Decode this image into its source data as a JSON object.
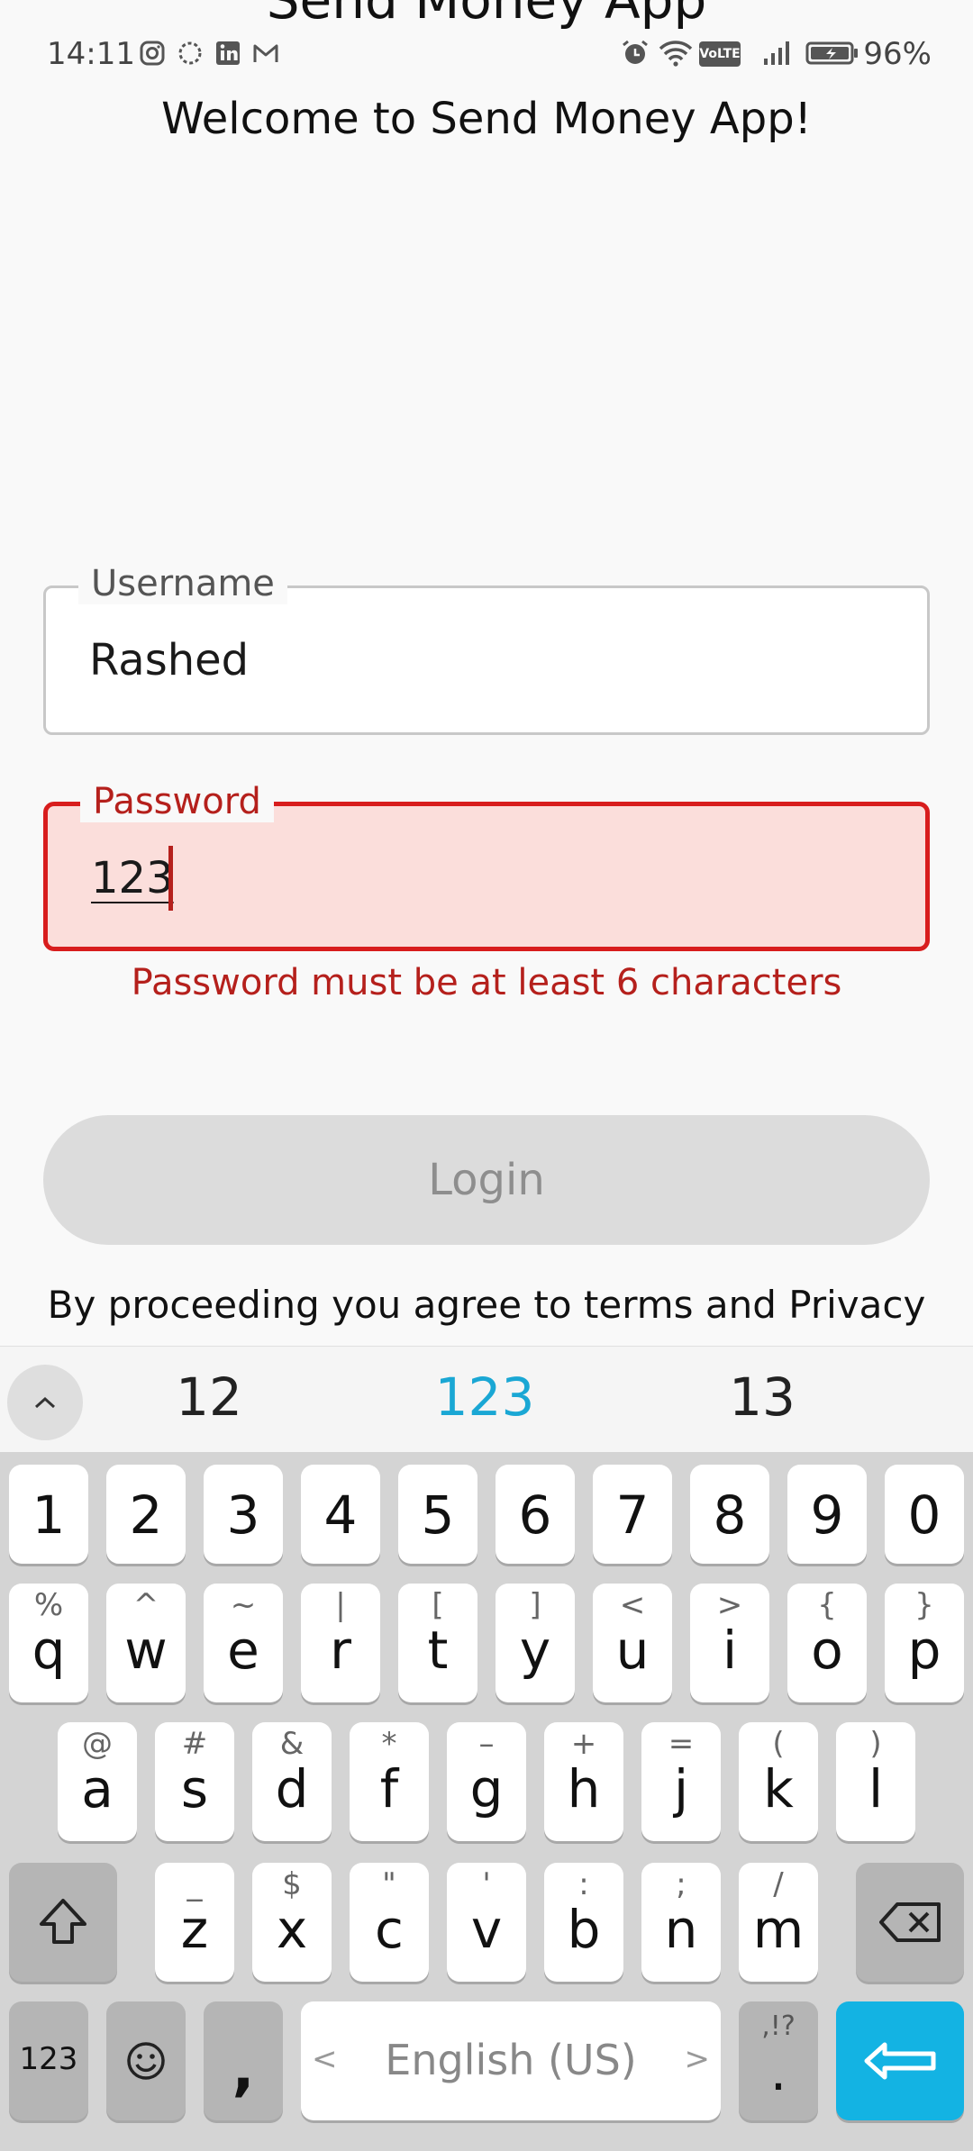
{
  "app_bar": {
    "title": "Send Money App"
  },
  "status_bar": {
    "time": "14:11",
    "left_icons": [
      "instagram-icon",
      "loading-circle-icon",
      "linkedin-icon",
      "gmail-icon"
    ],
    "right_icons": [
      "alarm-icon",
      "wifi-icon",
      "volte-icon",
      "signal-icon",
      "battery-icon"
    ],
    "volte_label": "VoLTE",
    "battery_percent": "96%"
  },
  "welcome_text": "Welcome to Send Money App!",
  "username_field": {
    "label": "Username",
    "value": "Rashed"
  },
  "password_field": {
    "label": "Password",
    "value": "123",
    "error": "Password must be at least 6 characters"
  },
  "login_button": {
    "label": "Login",
    "enabled": false
  },
  "terms_text": "By proceeding you agree to terms and Privacy",
  "keyboard": {
    "suggestions": [
      "12",
      "123",
      "13"
    ],
    "number_row": [
      "1",
      "2",
      "3",
      "4",
      "5",
      "6",
      "7",
      "8",
      "9",
      "0"
    ],
    "row1": [
      {
        "main": "q",
        "sub": "%"
      },
      {
        "main": "w",
        "sub": "^"
      },
      {
        "main": "e",
        "sub": "~"
      },
      {
        "main": "r",
        "sub": "|"
      },
      {
        "main": "t",
        "sub": "["
      },
      {
        "main": "y",
        "sub": "]"
      },
      {
        "main": "u",
        "sub": "<"
      },
      {
        "main": "i",
        "sub": ">"
      },
      {
        "main": "o",
        "sub": "{"
      },
      {
        "main": "p",
        "sub": "}"
      }
    ],
    "row2": [
      {
        "main": "a",
        "sub": "@"
      },
      {
        "main": "s",
        "sub": "#"
      },
      {
        "main": "d",
        "sub": "&"
      },
      {
        "main": "f",
        "sub": "*"
      },
      {
        "main": "g",
        "sub": "–"
      },
      {
        "main": "h",
        "sub": "+"
      },
      {
        "main": "j",
        "sub": "="
      },
      {
        "main": "k",
        "sub": "("
      },
      {
        "main": "l",
        "sub": ")"
      }
    ],
    "row3": [
      {
        "main": "z",
        "sub": "_"
      },
      {
        "main": "x",
        "sub": "$"
      },
      {
        "main": "c",
        "sub": "\""
      },
      {
        "main": "v",
        "sub": "'"
      },
      {
        "main": "b",
        "sub": ":"
      },
      {
        "main": "n",
        "sub": ";"
      },
      {
        "main": "m",
        "sub": "/"
      }
    ],
    "symbols_key": "123",
    "comma_key": ",",
    "space_label": "English (US)",
    "space_left_arrow": "<",
    "space_right_arrow": ">",
    "period_key": ".",
    "period_sub": ",!?",
    "accent_color": "#13b3e3"
  }
}
